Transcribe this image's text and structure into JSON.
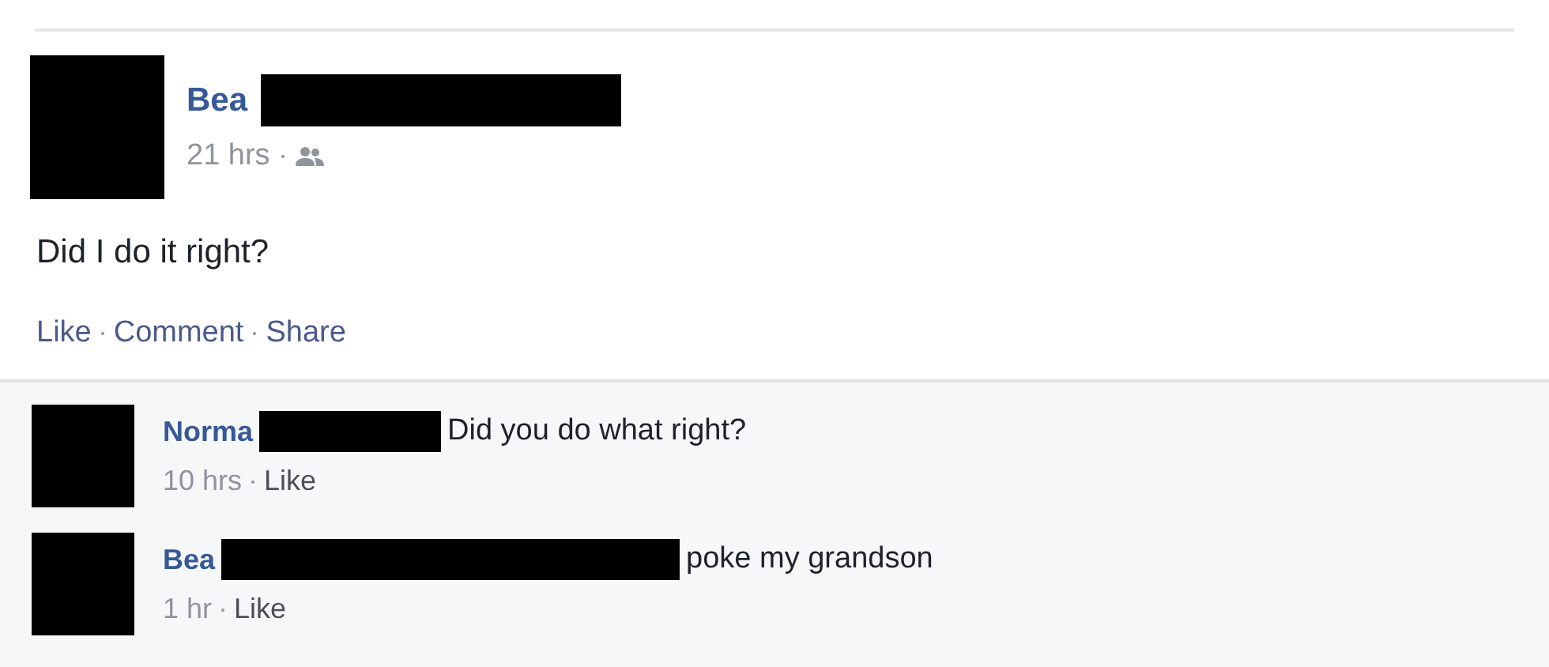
{
  "post": {
    "author": "Bea",
    "time": "21 hrs",
    "text": "Did I do it right?",
    "actions": [
      "Like",
      "Comment",
      "Share"
    ]
  },
  "comments": [
    {
      "author": "Norma",
      "text": "Did you do what right?",
      "time": "10 hrs",
      "action": "Like"
    },
    {
      "author": "Bea",
      "text": "poke my grandson",
      "time": "1 hr",
      "action": "Like"
    }
  ]
}
